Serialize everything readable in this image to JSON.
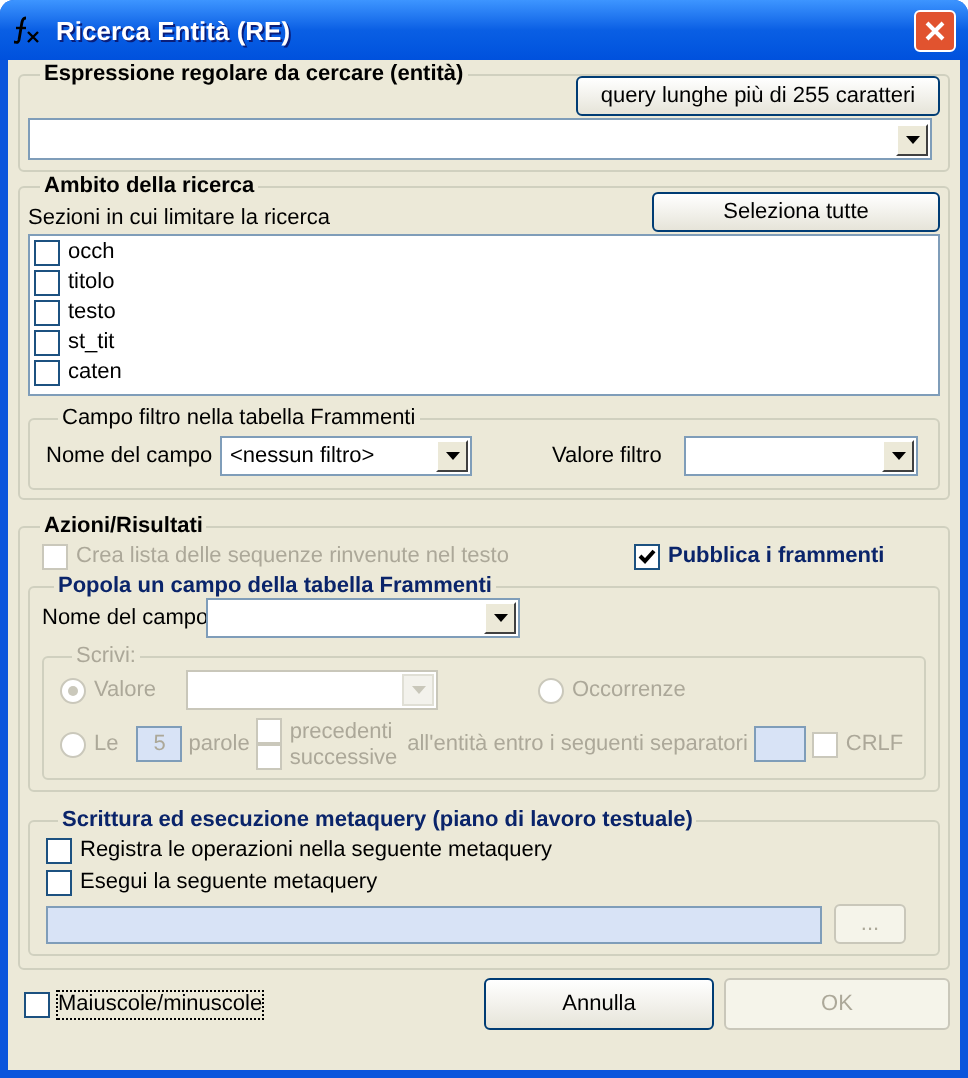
{
  "window": {
    "title": "Ricerca Entità (RE)"
  },
  "expression_group": {
    "title": "Espressione regolare da cercare (entità)",
    "long_query_button": "query lunghe più di 255 caratteri"
  },
  "scope_group": {
    "title": "Ambito della ricerca",
    "sections_label": "Sezioni in cui limitare la ricerca",
    "select_all_button": "Seleziona tutte",
    "sections": [
      {
        "label": "occh",
        "checked": false
      },
      {
        "label": "titolo",
        "checked": false
      },
      {
        "label": "testo",
        "checked": false
      },
      {
        "label": "st_tit",
        "checked": false
      },
      {
        "label": "caten",
        "checked": false
      }
    ],
    "filter_group": {
      "title": "Campo filtro nella tabella Frammenti",
      "field_label": "Nome del campo",
      "field_value": "<nessun filtro>",
      "filter_value_label": "Valore filtro"
    }
  },
  "actions_group": {
    "title": "Azioni/Risultati",
    "options": [
      {
        "label": "Crea lista delle sequenze rinvenute nel testo",
        "checked": false,
        "disabled": true
      },
      {
        "label": "Pubblica i frammenti",
        "checked": true,
        "disabled": false
      }
    ],
    "populate_group": {
      "title": "Popola un campo della tabella Frammenti",
      "field_label": "Nome del campo",
      "write_group": {
        "title": "Scrivi:",
        "disabled": true,
        "radios": [
          {
            "label": "Valore",
            "selected": true
          },
          {
            "label": "Occorrenze",
            "selected": false
          },
          {
            "label": "Le",
            "selected": false
          }
        ],
        "word_count": "5",
        "words_label": "parole",
        "directions": [
          {
            "label": "precedenti",
            "checked": false
          },
          {
            "label": "successive",
            "checked": false
          }
        ],
        "separators_label": "all'entità entro i seguenti separatori",
        "crlf": {
          "label": "CRLF",
          "checked": false
        }
      }
    },
    "metaquery_group": {
      "title": "Scrittura ed esecuzione metaquery (piano di lavoro testuale)",
      "options": [
        {
          "label": "Registra le operazioni nella seguente metaquery",
          "checked": false
        },
        {
          "label": "Esegui la seguente metaquery",
          "checked": false
        }
      ],
      "browse_button": {
        "label": "...",
        "disabled": true
      }
    }
  },
  "case_option": {
    "label": "Maiuscole/minuscole",
    "checked": false
  },
  "buttons": [
    {
      "label": "Annulla",
      "disabled": false
    },
    {
      "label": "OK",
      "disabled": true
    }
  ]
}
